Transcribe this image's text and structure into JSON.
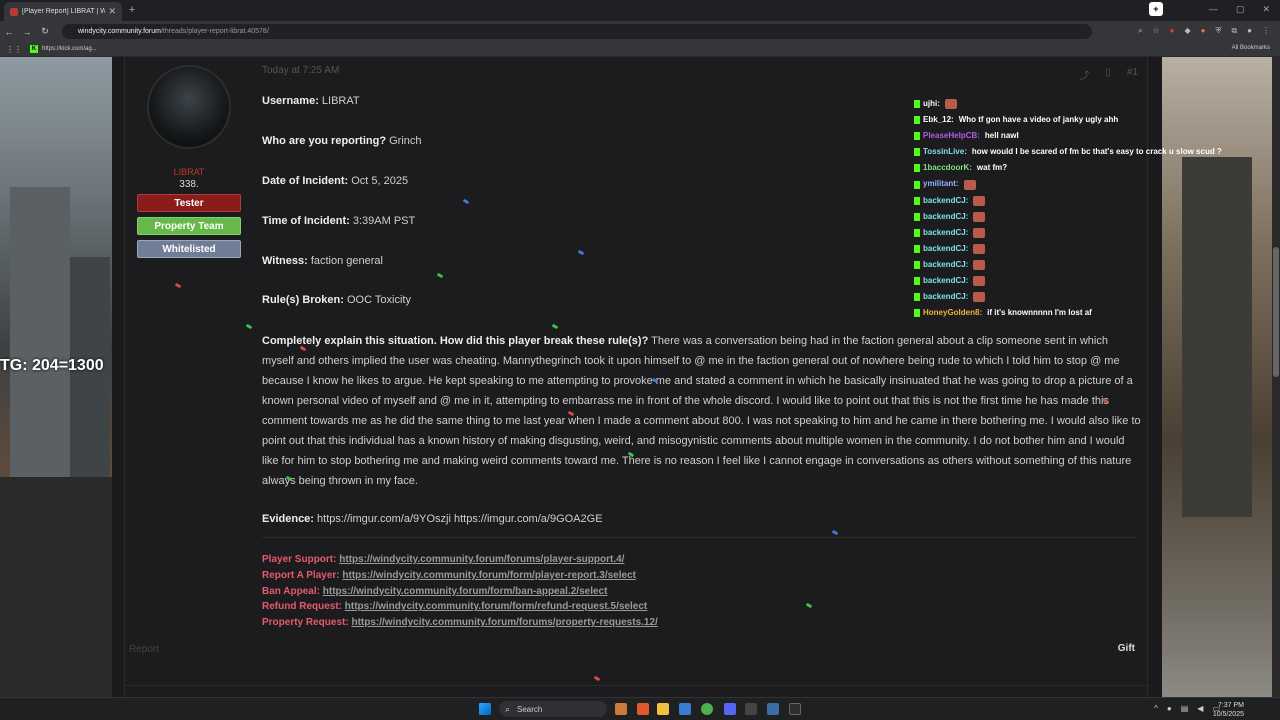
{
  "browser": {
    "tab_title": "[Player Report] LIBRAT | Windy",
    "url_host": "windycity.community.forum",
    "url_path": "/threads/player-report-librat.40578/",
    "bookmark": "https://kick.com/ag...",
    "all_bookmarks": "All Bookmarks"
  },
  "user": {
    "name": "LIBRAT",
    "count": "338.",
    "roles": [
      "Tester",
      "Property Team",
      "Whitelisted"
    ]
  },
  "post": {
    "time": "Today at 7:25 AM",
    "number": "#1",
    "fields": [
      {
        "label": "Username:",
        "value": "LIBRAT"
      },
      {
        "label": "Who are you reporting?",
        "value": "Grinch"
      },
      {
        "label": "Date of Incident:",
        "value": "Oct 5, 2025"
      },
      {
        "label": "Time of Incident:",
        "value": "3:39AM PST"
      },
      {
        "label": "Witness:",
        "value": "faction general"
      },
      {
        "label": "Rule(s) Broken:",
        "value": "OOC Toxicity"
      }
    ],
    "explain_label": "Completely explain this situation. How did this player break these rule(s)?",
    "explain_text": "There was a conversation being had in the faction general about a clip someone sent in which myself and others implied the user was cheating. Mannythegrinch took it upon himself to @ me in the faction general out of nowhere being rude to which I told him to stop @ me because I know he likes to argue. He kept speaking to me attempting to provoke me and stated a comment in which he basically insinuated that he was going to drop a picture of a known personal video of myself and @ me in it, attempting to embarrass me in front of the whole discord. I would like to point out that this is not the first time he has made this comment towards me as he did the same thing to me last year when I made a comment about 800. I was not speaking to him and he came in there bothering me. I would also like to point out that this individual has a known history of making disgusting, weird, and misogynistic comments about multiple women in the community. I do not bother him and I would like for him to stop bothering me and making weird comments toward me. There is no reason I feel like I cannot engage in conversations as others without something of this nature always being thrown in my face.",
    "evidence_label": "Evidence:",
    "evidence_value": "https://imgur.com/a/9YOszji https://imgur.com/a/9GOA2GE",
    "links": [
      {
        "label": "Player Support:",
        "url": "https://windycity.community.forum/forums/player-support.4/"
      },
      {
        "label": "Report A Player:",
        "url": "https://windycity.community.forum/form/player-report.3/select"
      },
      {
        "label": "Ban Appeal:",
        "url": "https://windycity.community.forum/form/ban-appeal.2/select"
      },
      {
        "label": "Refund Request:",
        "url": "https://windycity.community.forum/form/refund-request.5/select"
      },
      {
        "label": "Property Request:",
        "url": "https://windycity.community.forum/forums/property-requests.12/"
      }
    ],
    "report_label": "Report",
    "gift_label": "Gift"
  },
  "chat": [
    {
      "user": "ujhi:",
      "color": "#ffffff",
      "msg": "",
      "emote": true
    },
    {
      "user": "Ebk_12:",
      "color": "#ffffff",
      "msg": "Who tf gon have a video of janky ugly ahh",
      "emote": false
    },
    {
      "user": "PleaseHelpCB:",
      "color": "#b05ce6",
      "msg": "hell nawl",
      "emote": false
    },
    {
      "user": "TossinLive:",
      "color": "#7ee0e6",
      "msg": "how would I be scared of fm bc that's easy to crack u slow scud ?",
      "emote": false
    },
    {
      "user": "1baccdoorK:",
      "color": "#7ee07e",
      "msg": "wat fm?",
      "emote": false
    },
    {
      "user": "ymilitant:",
      "color": "#8fb3ff",
      "msg": "",
      "emote": true
    },
    {
      "user": "backendCJ:",
      "color": "#7ee0e6",
      "msg": "",
      "emote": true
    },
    {
      "user": "backendCJ:",
      "color": "#7ee0e6",
      "msg": "",
      "emote": true
    },
    {
      "user": "backendCJ:",
      "color": "#7ee0e6",
      "msg": "",
      "emote": true
    },
    {
      "user": "backendCJ:",
      "color": "#7ee0e6",
      "msg": "",
      "emote": true
    },
    {
      "user": "backendCJ:",
      "color": "#7ee0e6",
      "msg": "",
      "emote": true
    },
    {
      "user": "backendCJ:",
      "color": "#7ee0e6",
      "msg": "",
      "emote": true
    },
    {
      "user": "backendCJ:",
      "color": "#7ee0e6",
      "msg": "",
      "emote": true
    },
    {
      "user": "HoneyGolden8:",
      "color": "#f0b040",
      "msg": "if it's knownnnnn I'm lost af",
      "emote": false
    }
  ],
  "overlay": {
    "text": "TG: 204=1300"
  },
  "taskbar": {
    "search_label": "Search",
    "time": "7:37 PM",
    "date": "10/5/2025"
  }
}
